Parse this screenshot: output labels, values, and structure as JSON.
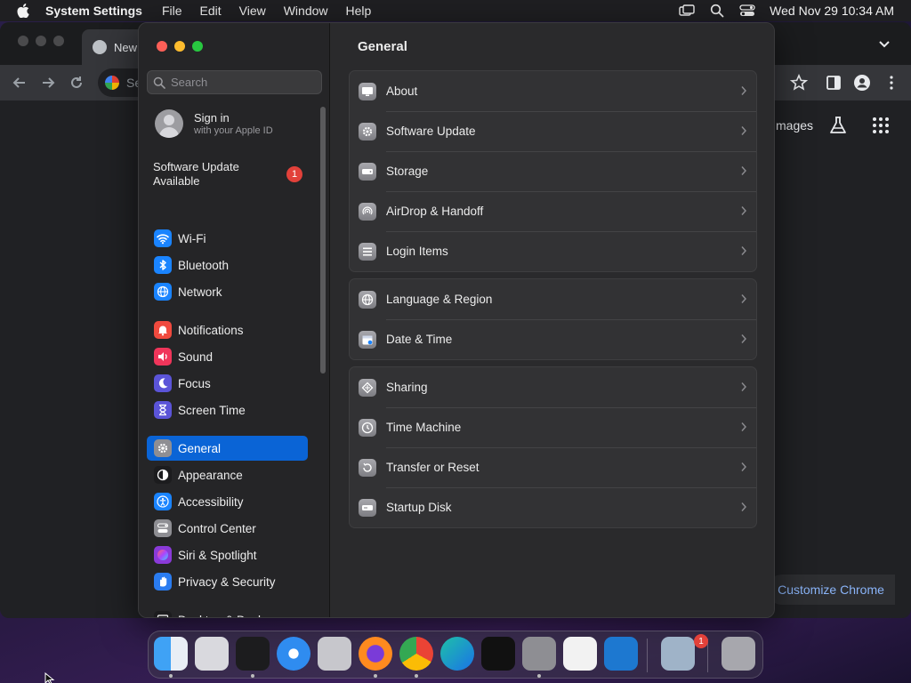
{
  "menubar": {
    "app_name": "System Settings",
    "menus": [
      "File",
      "Edit",
      "View",
      "Window",
      "Help"
    ],
    "clock": "Wed Nov 29  10:34 AM"
  },
  "chrome": {
    "tab_title": "New",
    "omnibox_text": "Se",
    "images_link": "mages",
    "customize_button": "Customize Chrome"
  },
  "sidebar": {
    "search_placeholder": "Search",
    "sign_in_title": "Sign in",
    "sign_in_subtitle": "with your Apple ID",
    "software_update_label": "Software Update Available",
    "software_update_badge": "1",
    "items": [
      {
        "label": "Wi-Fi",
        "icon": "wifi-icon",
        "color": "#1a84ff"
      },
      {
        "label": "Bluetooth",
        "icon": "bluetooth-icon",
        "color": "#1a84ff"
      },
      {
        "label": "Network",
        "icon": "globe-icon",
        "color": "#1a84ff"
      },
      {
        "label": "Notifications",
        "icon": "bell-icon",
        "color": "#f04a3e"
      },
      {
        "label": "Sound",
        "icon": "speaker-icon",
        "color": "#f0355a"
      },
      {
        "label": "Focus",
        "icon": "moon-icon",
        "color": "#5b54d8"
      },
      {
        "label": "Screen Time",
        "icon": "hourglass-icon",
        "color": "#5b54d8"
      },
      {
        "label": "General",
        "icon": "gear-icon",
        "color": "#8e8e93"
      },
      {
        "label": "Appearance",
        "icon": "appearance-icon",
        "color": "#1c1c1e"
      },
      {
        "label": "Accessibility",
        "icon": "accessibility-icon",
        "color": "#1a84ff"
      },
      {
        "label": "Control Center",
        "icon": "toggles-icon",
        "color": "#8e8e93"
      },
      {
        "label": "Siri & Spotlight",
        "icon": "siri-icon",
        "color": "#8a3ad8"
      },
      {
        "label": "Privacy & Security",
        "icon": "hand-icon",
        "color": "#2a7cf0"
      },
      {
        "label": "Desktop & Dock",
        "icon": "dock-icon",
        "color": "#1c1c1e"
      }
    ]
  },
  "main": {
    "title": "General",
    "groups": [
      [
        {
          "label": "About",
          "icon": "monitor-icon"
        },
        {
          "label": "Software Update",
          "icon": "gear-badge-icon"
        },
        {
          "label": "Storage",
          "icon": "drive-icon"
        },
        {
          "label": "AirDrop & Handoff",
          "icon": "airdrop-icon"
        },
        {
          "label": "Login Items",
          "icon": "list-icon"
        }
      ],
      [
        {
          "label": "Language & Region",
          "icon": "globe-icon"
        },
        {
          "label": "Date & Time",
          "icon": "calendar-icon"
        }
      ],
      [
        {
          "label": "Sharing",
          "icon": "sharing-icon"
        },
        {
          "label": "Time Machine",
          "icon": "time-machine-icon"
        },
        {
          "label": "Transfer or Reset",
          "icon": "reset-icon"
        },
        {
          "label": "Startup Disk",
          "icon": "disk-icon"
        }
      ]
    ]
  },
  "dock": {
    "badge": "1"
  }
}
